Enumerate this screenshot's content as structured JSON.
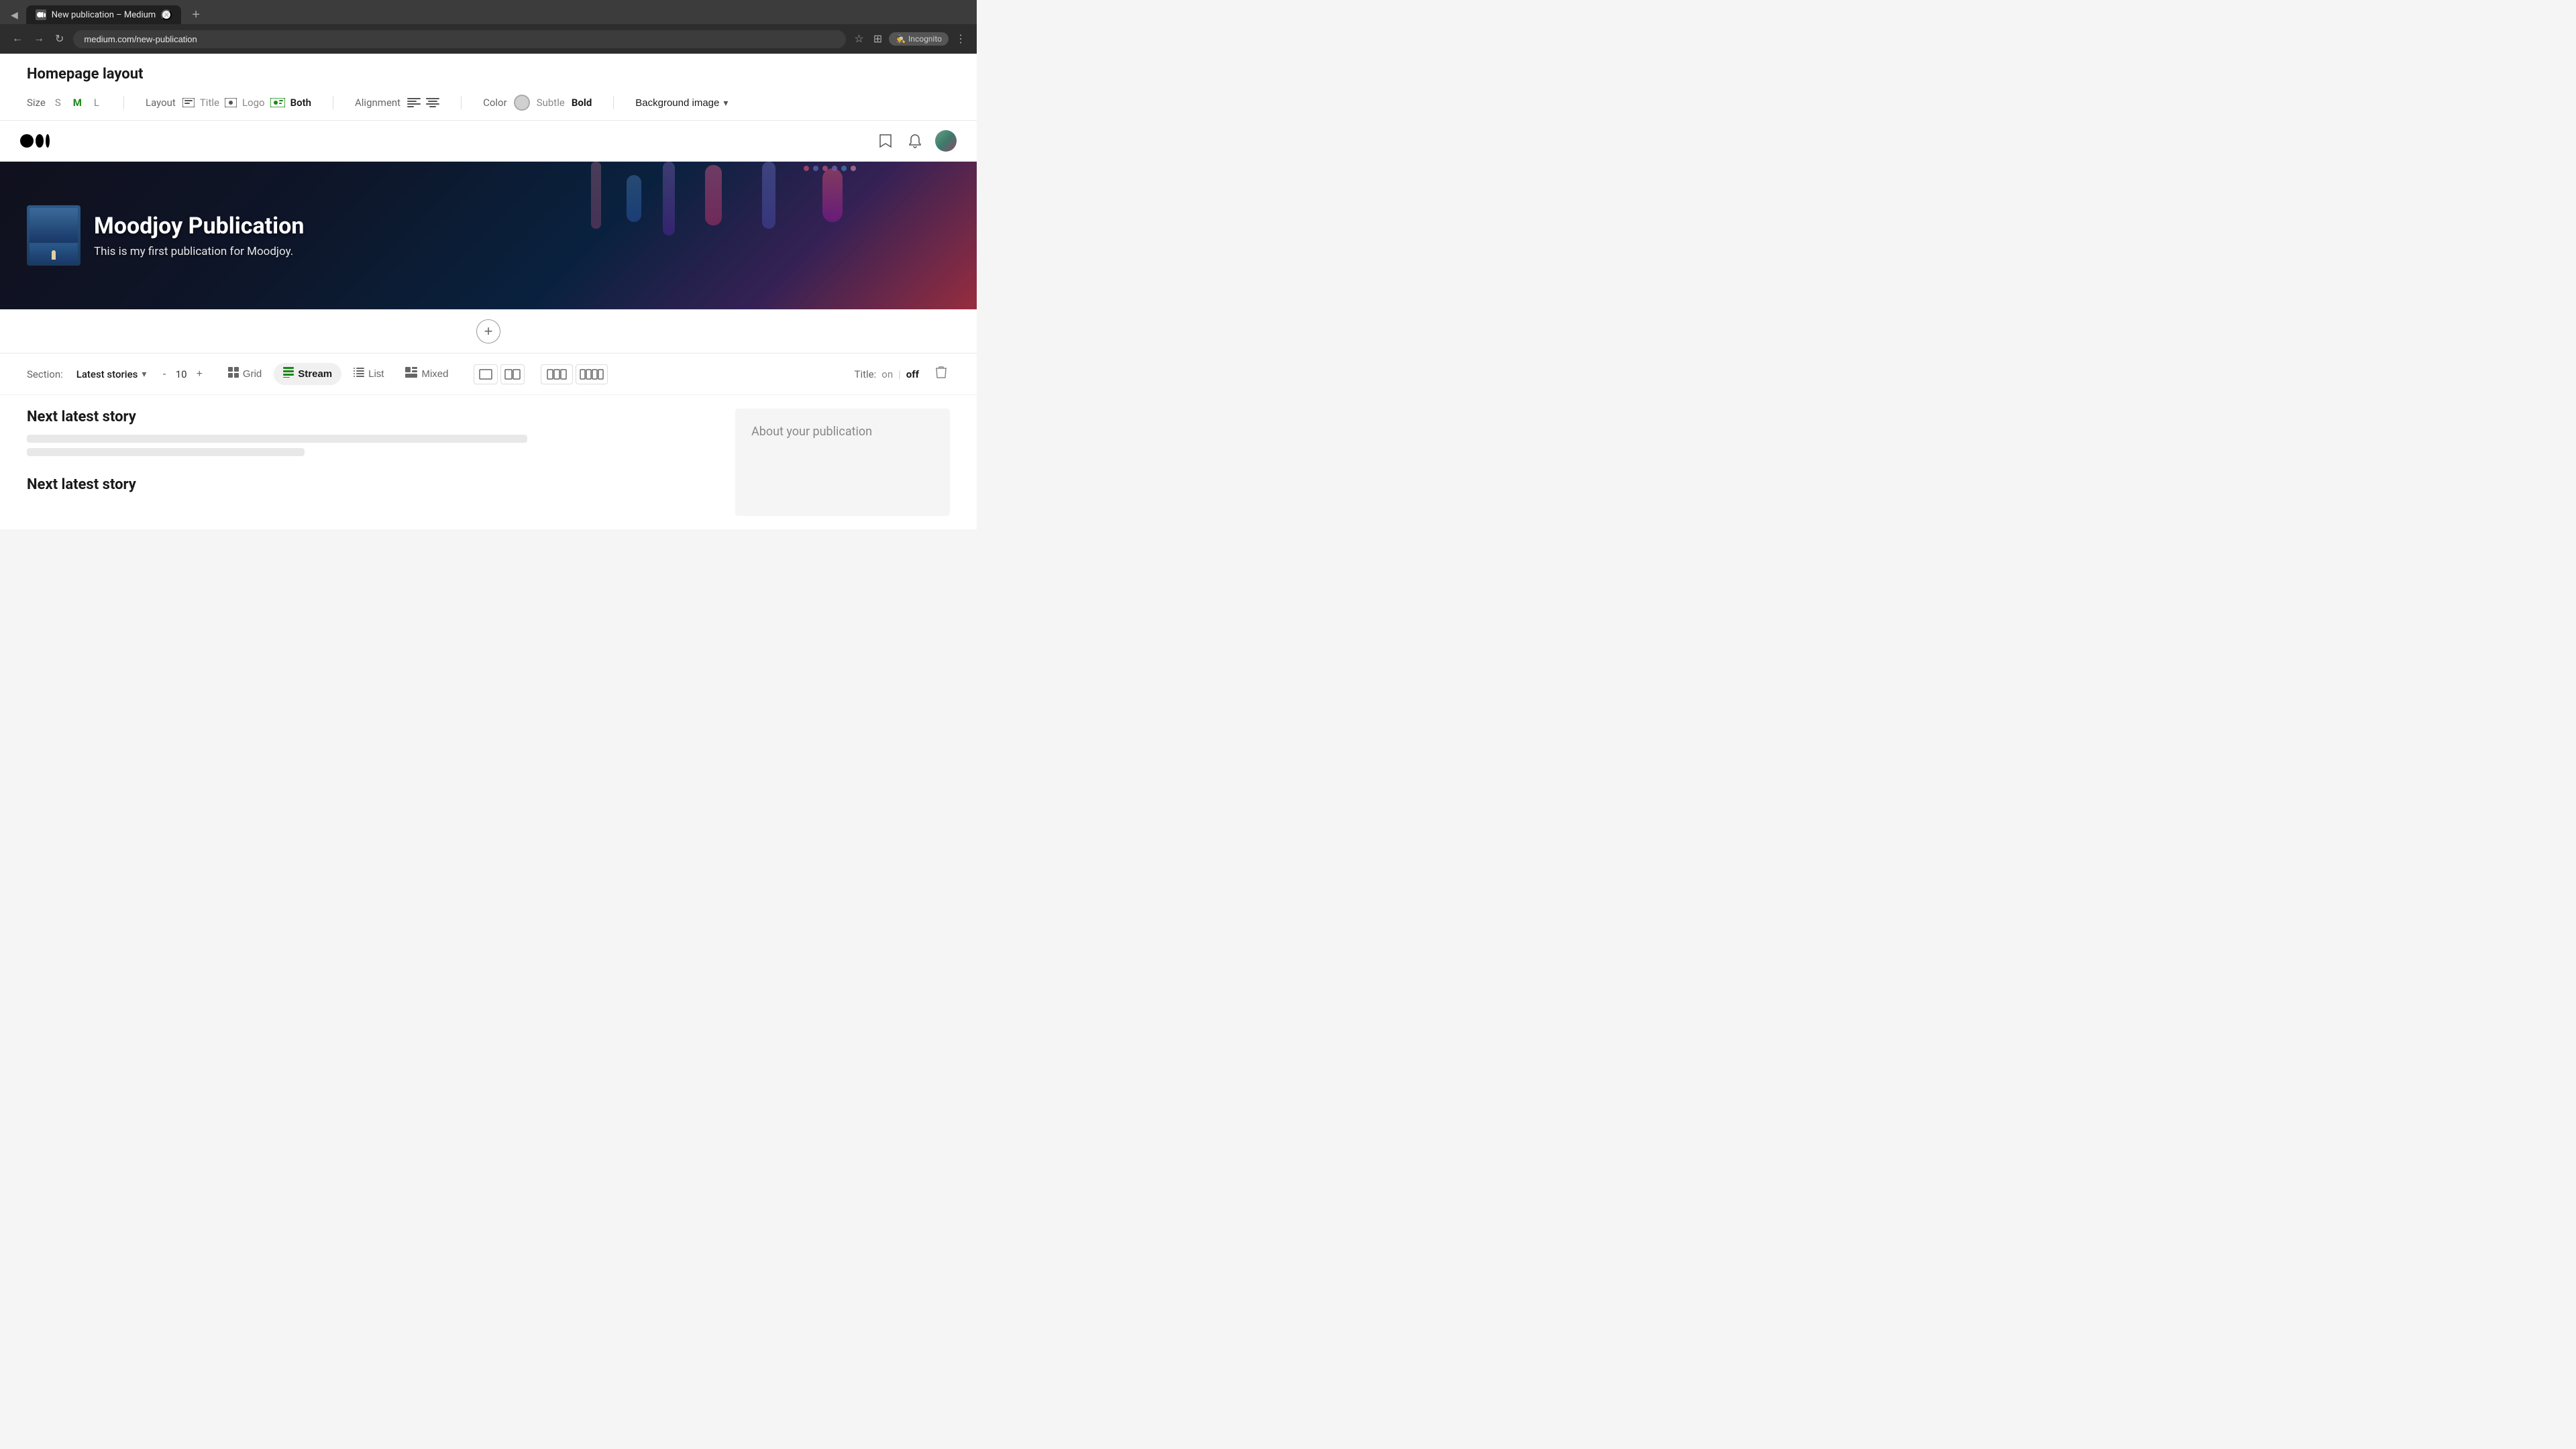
{
  "browser": {
    "tab_title": "New publication – Medium",
    "tab_favicon": "M",
    "address": "medium.com/new-publication",
    "incognito_label": "Incognito"
  },
  "page": {
    "layout_header": "Homepage layout",
    "size_label": "Size",
    "sizes": [
      "S",
      "M",
      "L"
    ],
    "active_size": "M",
    "layout_label": "Layout",
    "layout_title": "Title",
    "layout_logo": "Logo",
    "layout_both": "Both",
    "alignment_label": "Alignment",
    "color_label": "Color",
    "color_subtle": "Subtle",
    "color_bold": "Bold",
    "bg_image_label": "Background image",
    "hero_title": "Moodjoy Publication",
    "hero_subtitle": "This is my first publication for Moodjoy.",
    "section_label": "Section:",
    "section_name": "Latest stories",
    "count": "10",
    "view_grid": "Grid",
    "view_stream": "Stream",
    "view_list": "List",
    "view_mixed": "Mixed",
    "title_label": "Title:",
    "title_on": "on",
    "title_off": "off",
    "story1_title": "Next latest story",
    "story2_title": "Next latest story",
    "sidebar_title": "About your publication",
    "add_section_label": "+"
  }
}
